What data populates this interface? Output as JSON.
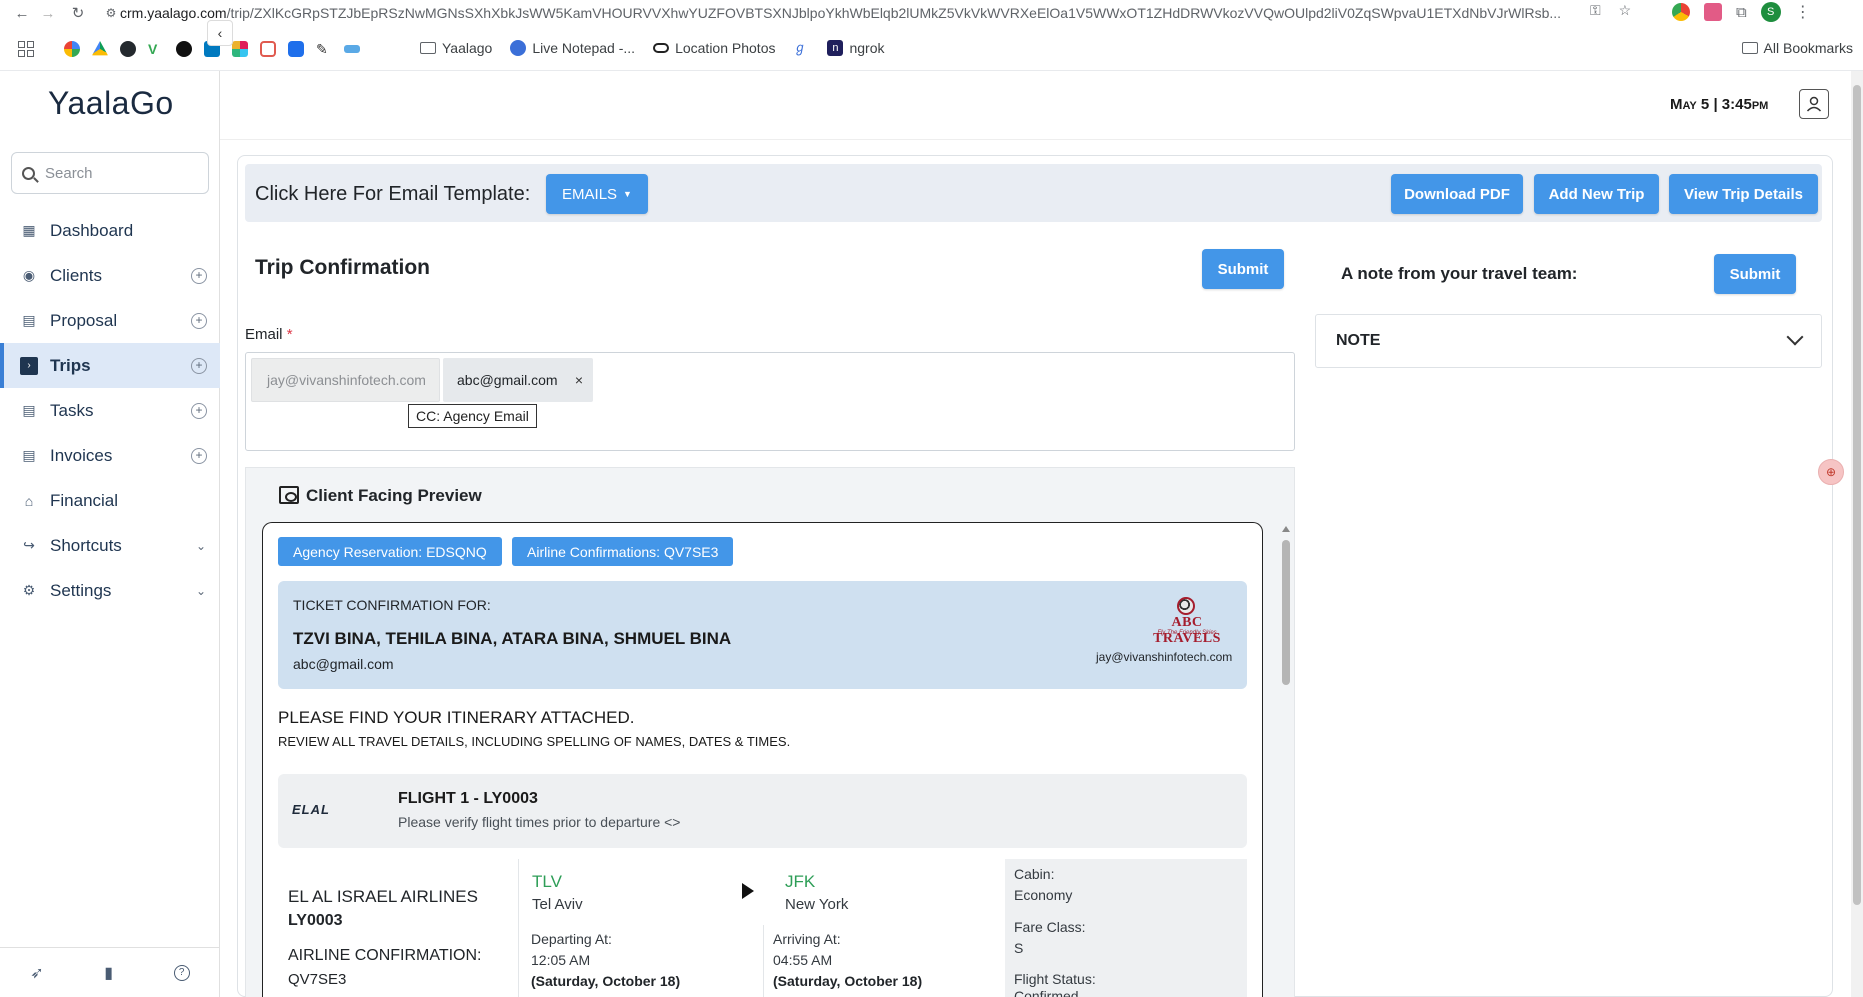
{
  "browser": {
    "url_host": "crm.yaalago.com",
    "url_path": "/trip/ZXlKcGRpSTZJbEpRSzNwMGNsSXhXbkJsWW5KamVHOURVVXhwYUZFOVBTSXNJblpoYkhWbElqb2lUMkZ5VkVkWVRXeElOa1V5WWxOT1ZHdDRWVkozVVQwOUlpd2liV0ZqSWpvaU1ETXdNbVJrWlRsb...",
    "bookmarks": [
      "Yaalago",
      "Live Notepad -...",
      "Location Photos",
      "ngrok"
    ],
    "all_bookmarks": "All Bookmarks",
    "profile_initial": "S"
  },
  "sidebar": {
    "brand": "YaalaGo",
    "search_placeholder": "Search",
    "items": [
      {
        "label": "Dashboard"
      },
      {
        "label": "Clients"
      },
      {
        "label": "Proposal"
      },
      {
        "label": "Trips"
      },
      {
        "label": "Tasks"
      },
      {
        "label": "Invoices"
      },
      {
        "label": "Financial"
      },
      {
        "label": "Shortcuts"
      },
      {
        "label": "Settings"
      }
    ]
  },
  "header": {
    "datetime": "May 5 | 3:45pm"
  },
  "toolbar": {
    "template_label": "Click Here For Email Template:",
    "emails_label": "EMAILS",
    "download_pdf": "Download PDF",
    "add_new_trip": "Add New Trip",
    "view_trip_details": "View Trip Details"
  },
  "form": {
    "title": "Trip Confirmation",
    "submit": "Submit",
    "email_label": "Email",
    "required_mark": "*",
    "agency_email": "jay@vivanshinfotech.com",
    "client_email": "abc@gmail.com",
    "chip_remove": "×",
    "tooltip": "CC: Agency Email"
  },
  "note": {
    "title": "A note from your travel team:",
    "submit": "Submit",
    "accordion_label": "NOTE"
  },
  "preview": {
    "title": "Client Facing Preview",
    "agency_reservation": "Agency Reservation: EDSQNQ",
    "airline_confirmations": "Airline Confirmations: QV7SE3",
    "ticket_label": "TICKET CONFIRMATION FOR:",
    "passengers": "TZVI BINA, TEHILA BINA, ATARA BINA, SHMUEL BINA",
    "client_email": "abc@gmail.com",
    "logo_name": "ABC TRAVELS",
    "logo_tagline": "Fly The Friendly Skies",
    "agency_email": "jay@vivanshinfotech.com",
    "itinerary_heading": "PLEASE FIND YOUR ITINERARY ATTACHED.",
    "itinerary_sub": "REVIEW ALL TRAVEL DETAILS, INCLUDING SPELLING OF NAMES, DATES & TIMES.",
    "airline_logo": "ELAL",
    "flight": {
      "title": "FLIGHT 1 - LY0003",
      "subtitle": "Please verify flight times prior to departure <>",
      "airline": "EL AL ISRAEL AIRLINES",
      "number": "LY0003",
      "conf_label": "AIRLINE CONFIRMATION:",
      "conf_value": "QV7SE3",
      "dep_code": "TLV",
      "dep_city": "Tel Aviv",
      "arr_code": "JFK",
      "arr_city": "New York",
      "dep_label": "Departing At:",
      "dep_time": "12:05 AM",
      "dep_date": "(Saturday, October 18)",
      "arr_label": "Arriving At:",
      "arr_time": "04:55 AM",
      "arr_date": "(Saturday, October 18)",
      "cabin_label": "Cabin:",
      "cabin_value": "Economy",
      "fare_label": "Fare Class:",
      "fare_value": "S",
      "status_label": "Flight Status:",
      "status_value": "Confirmed"
    }
  },
  "colors": {
    "primary": "#4396e8",
    "airport_code": "#2e9e57",
    "sidebar_active": "#dde8f7"
  }
}
